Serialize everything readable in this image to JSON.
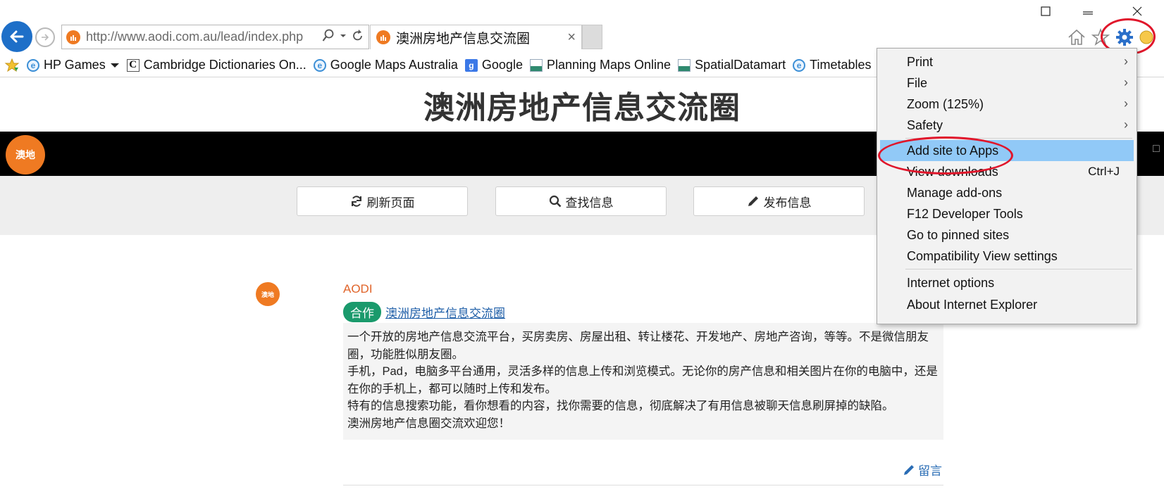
{
  "browser": {
    "url": "http://www.aodi.com.au/lead/index.php",
    "tab_title": "澳洲房地产信息交流圈",
    "tab_close": "×"
  },
  "favorites": [
    {
      "label": "HP Games",
      "icon": "ie-icon",
      "dropdown": true
    },
    {
      "label": "Cambridge Dictionaries On...",
      "icon": "cambridge-icon"
    },
    {
      "label": "Google Maps Australia",
      "icon": "ie-icon"
    },
    {
      "label": "Google",
      "icon": "google-icon"
    },
    {
      "label": "Planning Maps Online",
      "icon": "land-icon"
    },
    {
      "label": "SpatialDatamart",
      "icon": "land-icon"
    },
    {
      "label": "Timetables",
      "icon": "ie-icon"
    }
  ],
  "page": {
    "heading": "澳洲房地产信息交流圈",
    "logo_text": "澳地",
    "nav": {
      "refresh": "刷新页面",
      "search": "查找信息",
      "publish": "发布信息"
    },
    "post": {
      "avatar_text": "澳地",
      "author": "AODI",
      "tag": "合作",
      "link": "澳洲房地产信息交流圈",
      "body": [
        "一个开放的房地产信息交流平台，买房卖房、房屋出租、转让楼花、开发地产、房地产咨询，等等。不是微信朋友圈，功能胜似朋友圈。",
        "手机，Pad，电脑多平台通用，灵活多样的信息上传和浏览模式。无论你的房产信息和相关图片在你的电脑中，还是在你的手机上，都可以随时上传和发布。",
        "特有的信息搜索功能，看你想看的内容，找你需要的信息，彻底解决了有用信息被聊天信息刷屏掉的缺陷。",
        "澳洲房地产信息圈交流欢迎您！"
      ],
      "reply": "留言"
    }
  },
  "tools_menu": {
    "print": "Print",
    "file": "File",
    "zoom": "Zoom (125%)",
    "safety": "Safety",
    "add_site": "Add site to Apps",
    "view_downloads": "View downloads",
    "view_downloads_shortcut": "Ctrl+J",
    "manage_addons": "Manage add-ons",
    "dev_tools": "F12 Developer Tools",
    "pinned_sites": "Go to pinned sites",
    "compat_view": "Compatibility View settings",
    "internet_options": "Internet options",
    "about_ie": "About Internet Explorer",
    "arrow": "›"
  },
  "colors": {
    "accent_blue": "#1e6fc8",
    "brand_orange": "#ef7a22",
    "highlight": "#91c9f7",
    "annotation_red": "#e0162b",
    "tag_green": "#1a9a6c"
  }
}
